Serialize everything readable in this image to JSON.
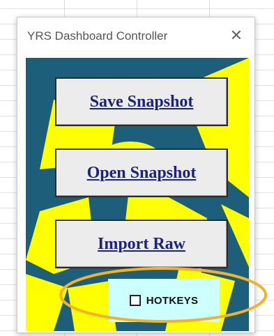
{
  "window": {
    "title": "YRS Dashboard Controller",
    "close_symbol": "✕"
  },
  "buttons": {
    "save": "Save Snapshot",
    "open": "Open Snapshot",
    "import": "Import Raw"
  },
  "hotkeys": {
    "label": "HOTKEYS",
    "checked": false
  },
  "colors": {
    "form_background": "#1d5f7a",
    "graphic": "#ffff00",
    "button_text": "#1a237e",
    "hotkeys_background": "#ccffff",
    "highlight_ring": "#f5b324"
  },
  "icons": [
    "close-icon",
    "checkbox-icon"
  ]
}
